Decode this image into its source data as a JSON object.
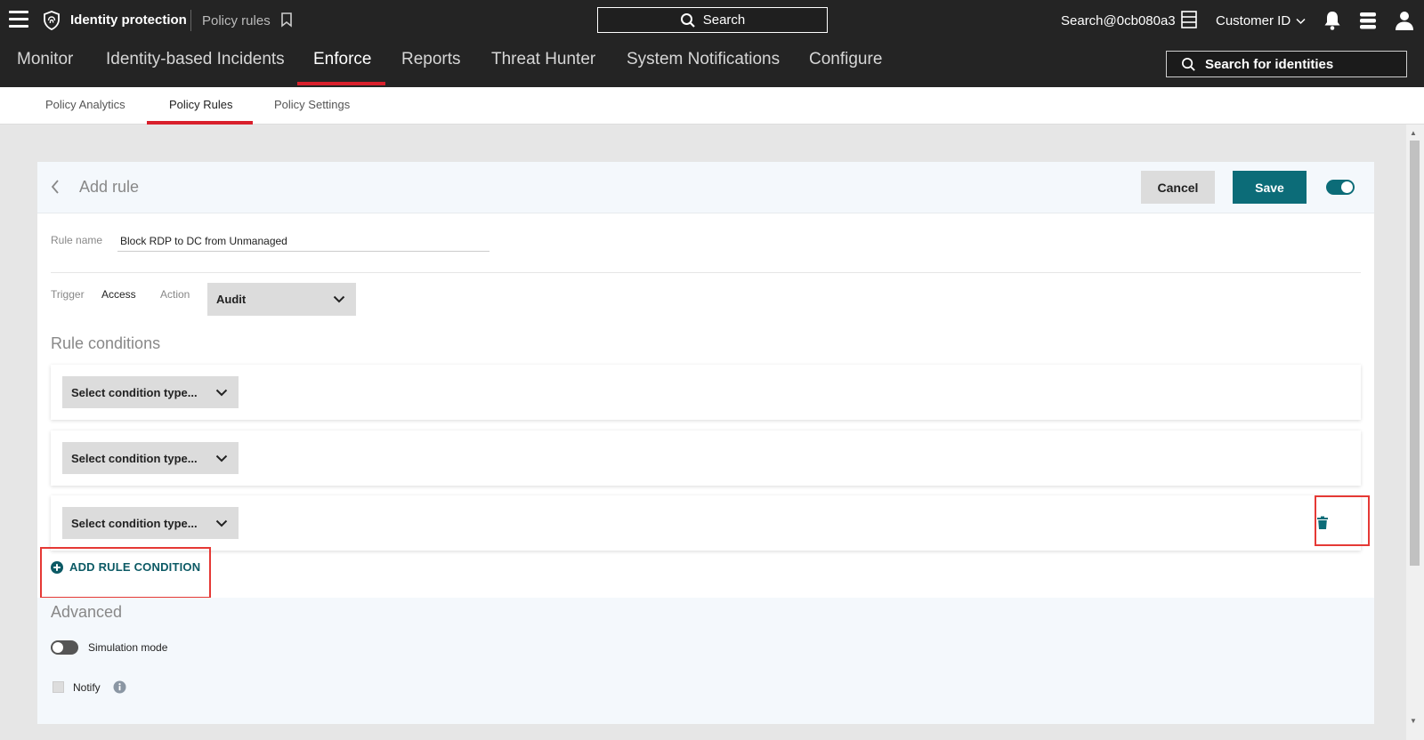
{
  "topbar": {
    "app_title": "Identity protection",
    "page_crumb": "Policy rules",
    "search_label": "Search",
    "user_email": "Search@0cb080a3",
    "customer_id_label": "Customer ID"
  },
  "main_nav": {
    "items": [
      {
        "label": "Monitor"
      },
      {
        "label": "Identity-based Incidents"
      },
      {
        "label": "Enforce",
        "active": true
      },
      {
        "label": "Reports"
      },
      {
        "label": "Threat Hunter"
      },
      {
        "label": "System Notifications"
      },
      {
        "label": "Configure"
      }
    ],
    "identity_search_label": "Search for identities"
  },
  "sub_nav": {
    "items": [
      {
        "label": "Policy Analytics"
      },
      {
        "label": "Policy Rules",
        "active": true
      },
      {
        "label": "Policy Settings"
      }
    ]
  },
  "card": {
    "title": "Add rule",
    "cancel_label": "Cancel",
    "save_label": "Save",
    "rule_name_label": "Rule name",
    "rule_name_value": "Block RDP to DC from Unmanaged",
    "trigger_label": "Trigger",
    "trigger_value": "Access",
    "action_label": "Action",
    "action_value": "Audit",
    "rule_conditions_title": "Rule conditions",
    "conditions": [
      {
        "placeholder": "Select condition type..."
      },
      {
        "placeholder": "Select condition type..."
      },
      {
        "placeholder": "Select condition type..."
      }
    ],
    "add_condition_label": "ADD RULE CONDITION",
    "advanced_title": "Advanced",
    "simulation_label": "Simulation mode",
    "notify_label": "Notify"
  },
  "colors": {
    "accent_teal": "#0c6c78",
    "accent_red": "#d9202c",
    "highlight_red": "#e53935",
    "topbar_bg": "#242424"
  }
}
